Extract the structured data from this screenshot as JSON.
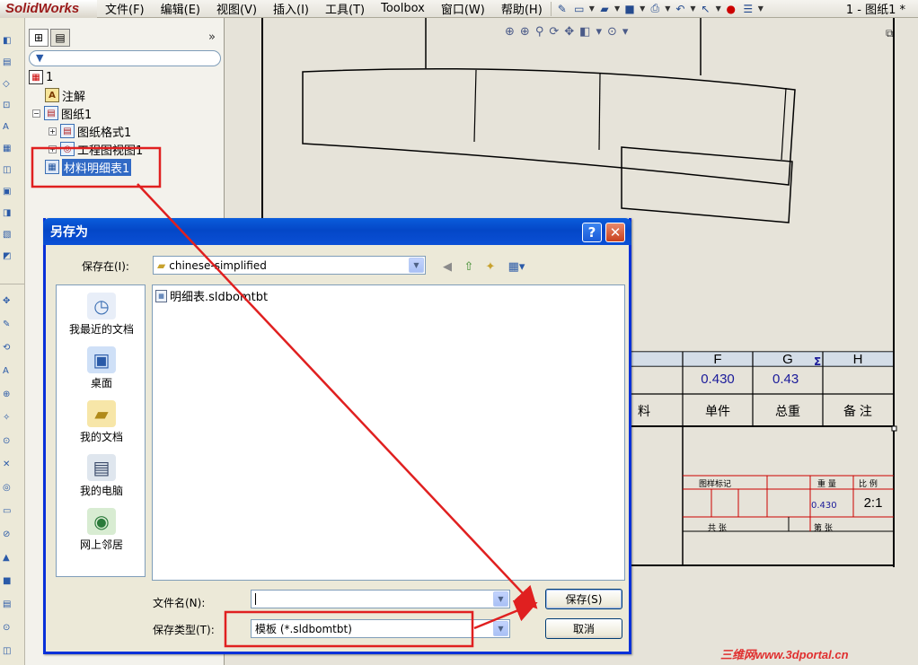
{
  "app": {
    "logo": "SolidWorks",
    "menu": [
      "文件(F)",
      "编辑(E)",
      "视图(V)",
      "插入(I)",
      "工具(T)",
      "Toolbox",
      "窗口(W)",
      "帮助(H)"
    ],
    "document_title": "1 - 图纸1 *"
  },
  "tree": {
    "items": [
      {
        "label": "1",
        "icon": "drawing-root-icon"
      },
      {
        "label": "注解",
        "icon": "annotation-icon"
      },
      {
        "label": "图纸1",
        "icon": "sheet-icon"
      },
      {
        "label": "图纸格式1",
        "icon": "sheet-format-icon"
      },
      {
        "label": "工程图视图1",
        "icon": "drawing-view-icon"
      },
      {
        "label": "材料明细表1",
        "icon": "bom-table-icon",
        "selected": true
      }
    ],
    "more": "»"
  },
  "drawing": {
    "columns": [
      "F",
      "G",
      "H"
    ],
    "values": [
      "0.430",
      "0.43",
      ""
    ],
    "headers": [
      "料",
      "单件",
      "总重",
      "备 注"
    ],
    "title_block": {
      "stage_mark": "图样标记",
      "weight": "重 量",
      "scale": "比 例",
      "weight_value": "0.430",
      "scale_value": "2:1",
      "total_sheets": "共 张",
      "sheet_no": "第 张"
    }
  },
  "dialog": {
    "title": "另存为",
    "save_in_label": "保存在(I):",
    "save_in_value": "chinese-simplified",
    "places": [
      "我最近的文档",
      "桌面",
      "我的文档",
      "我的电脑",
      "网上邻居"
    ],
    "files": [
      "明细表.sldbomtbt"
    ],
    "filename_label": "文件名(N):",
    "filename_value": "",
    "filetype_label": "保存类型(T):",
    "filetype_value": "模板 (*.sldbomtbt)",
    "save_button": "保存(S)",
    "cancel_button": "取消"
  },
  "watermark": "三维网www.3dportal.cn",
  "colors": {
    "highlight": "#e02020",
    "selection": "#316ac5",
    "xp_title": "#0447c7"
  }
}
